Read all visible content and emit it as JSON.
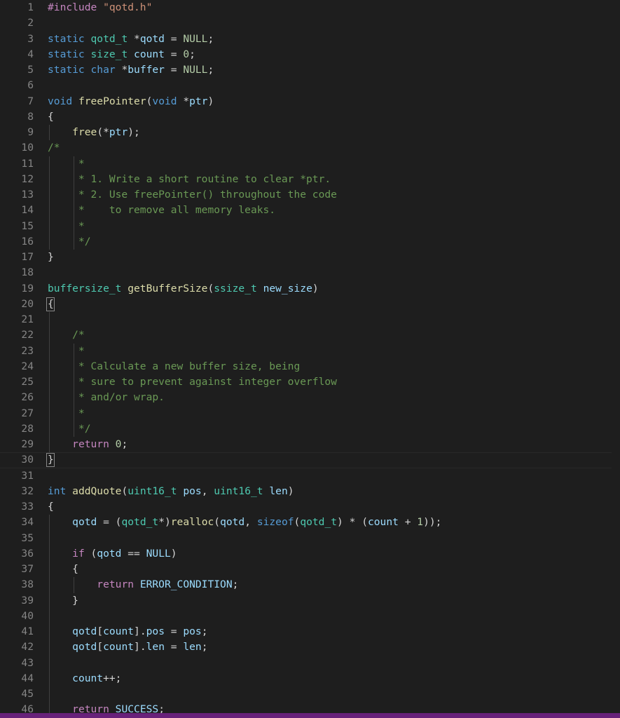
{
  "app": {
    "kind": "code-editor",
    "language": "C",
    "theme": "dark-plus",
    "background": "#1e1e1e",
    "line_number_color": "#858585",
    "active_line": 30,
    "status_bar_color": "#68217a"
  },
  "colors": {
    "keyword": "#569cd6",
    "control": "#c586c0",
    "type": "#4ec9b0",
    "variable": "#9cdcfe",
    "function": "#dcdcaa",
    "number": "#b5cea8",
    "string": "#ce9178",
    "comment": "#6a9955",
    "plain": "#d4d4d4",
    "indent_guide": "#404040",
    "active_line_border": "#282828"
  },
  "editor": {
    "first_visible_line": 1,
    "last_visible_line": 46,
    "lines": [
      {
        "n": 1,
        "indent": 0,
        "text": "#include \"qotd.h\""
      },
      {
        "n": 2,
        "indent": 0,
        "text": ""
      },
      {
        "n": 3,
        "indent": 0,
        "text": "static qotd_t *qotd = NULL;"
      },
      {
        "n": 4,
        "indent": 0,
        "text": "static size_t count = 0;"
      },
      {
        "n": 5,
        "indent": 0,
        "text": "static char *buffer = NULL;"
      },
      {
        "n": 6,
        "indent": 0,
        "text": ""
      },
      {
        "n": 7,
        "indent": 0,
        "text": "void freePointer(void *ptr)"
      },
      {
        "n": 8,
        "indent": 0,
        "text": "{"
      },
      {
        "n": 9,
        "indent": 1,
        "text": "    free(*ptr);"
      },
      {
        "n": 10,
        "indent": 0,
        "text": "/*"
      },
      {
        "n": 11,
        "indent": 2,
        "text": "     *"
      },
      {
        "n": 12,
        "indent": 2,
        "text": "     * 1. Write a short routine to clear *ptr."
      },
      {
        "n": 13,
        "indent": 2,
        "text": "     * 2. Use freePointer() throughout the code"
      },
      {
        "n": 14,
        "indent": 2,
        "text": "     *    to remove all memory leaks."
      },
      {
        "n": 15,
        "indent": 2,
        "text": "     *"
      },
      {
        "n": 16,
        "indent": 2,
        "text": "     */"
      },
      {
        "n": 17,
        "indent": 0,
        "text": "}"
      },
      {
        "n": 18,
        "indent": 0,
        "text": ""
      },
      {
        "n": 19,
        "indent": 0,
        "text": "buffersize_t getBufferSize(ssize_t new_size)"
      },
      {
        "n": 20,
        "indent": 0,
        "text": "{"
      },
      {
        "n": 21,
        "indent": 1,
        "text": ""
      },
      {
        "n": 22,
        "indent": 1,
        "text": "    /*"
      },
      {
        "n": 23,
        "indent": 1,
        "text": "     *"
      },
      {
        "n": 24,
        "indent": 1,
        "text": "     * Calculate a new buffer size, being"
      },
      {
        "n": 25,
        "indent": 1,
        "text": "     * sure to prevent against integer overflow"
      },
      {
        "n": 26,
        "indent": 1,
        "text": "     * and/or wrap."
      },
      {
        "n": 27,
        "indent": 1,
        "text": "     *"
      },
      {
        "n": 28,
        "indent": 1,
        "text": "     */"
      },
      {
        "n": 29,
        "indent": 1,
        "text": "    return 0;"
      },
      {
        "n": 30,
        "indent": 0,
        "text": "}"
      },
      {
        "n": 31,
        "indent": 0,
        "text": ""
      },
      {
        "n": 32,
        "indent": 0,
        "text": "int addQuote(uint16_t pos, uint16_t len)"
      },
      {
        "n": 33,
        "indent": 0,
        "text": "{"
      },
      {
        "n": 34,
        "indent": 1,
        "text": "    qotd = (qotd_t*)realloc(qotd, sizeof(qotd_t) * (count + 1));"
      },
      {
        "n": 35,
        "indent": 1,
        "text": ""
      },
      {
        "n": 36,
        "indent": 1,
        "text": "    if (qotd == NULL)"
      },
      {
        "n": 37,
        "indent": 1,
        "text": "    {"
      },
      {
        "n": 38,
        "indent": 2,
        "text": "        return ERROR_CONDITION;"
      },
      {
        "n": 39,
        "indent": 1,
        "text": "    }"
      },
      {
        "n": 40,
        "indent": 1,
        "text": ""
      },
      {
        "n": 41,
        "indent": 1,
        "text": "    qotd[count].pos = pos;"
      },
      {
        "n": 42,
        "indent": 1,
        "text": "    qotd[count].len = len;"
      },
      {
        "n": 43,
        "indent": 1,
        "text": ""
      },
      {
        "n": 44,
        "indent": 1,
        "text": "    count++;"
      },
      {
        "n": 45,
        "indent": 1,
        "text": ""
      },
      {
        "n": 46,
        "indent": 1,
        "text": "    return SUCCESS;"
      }
    ]
  },
  "bracket_match": {
    "open_line": 20,
    "close_line": 30,
    "char": "{"
  }
}
